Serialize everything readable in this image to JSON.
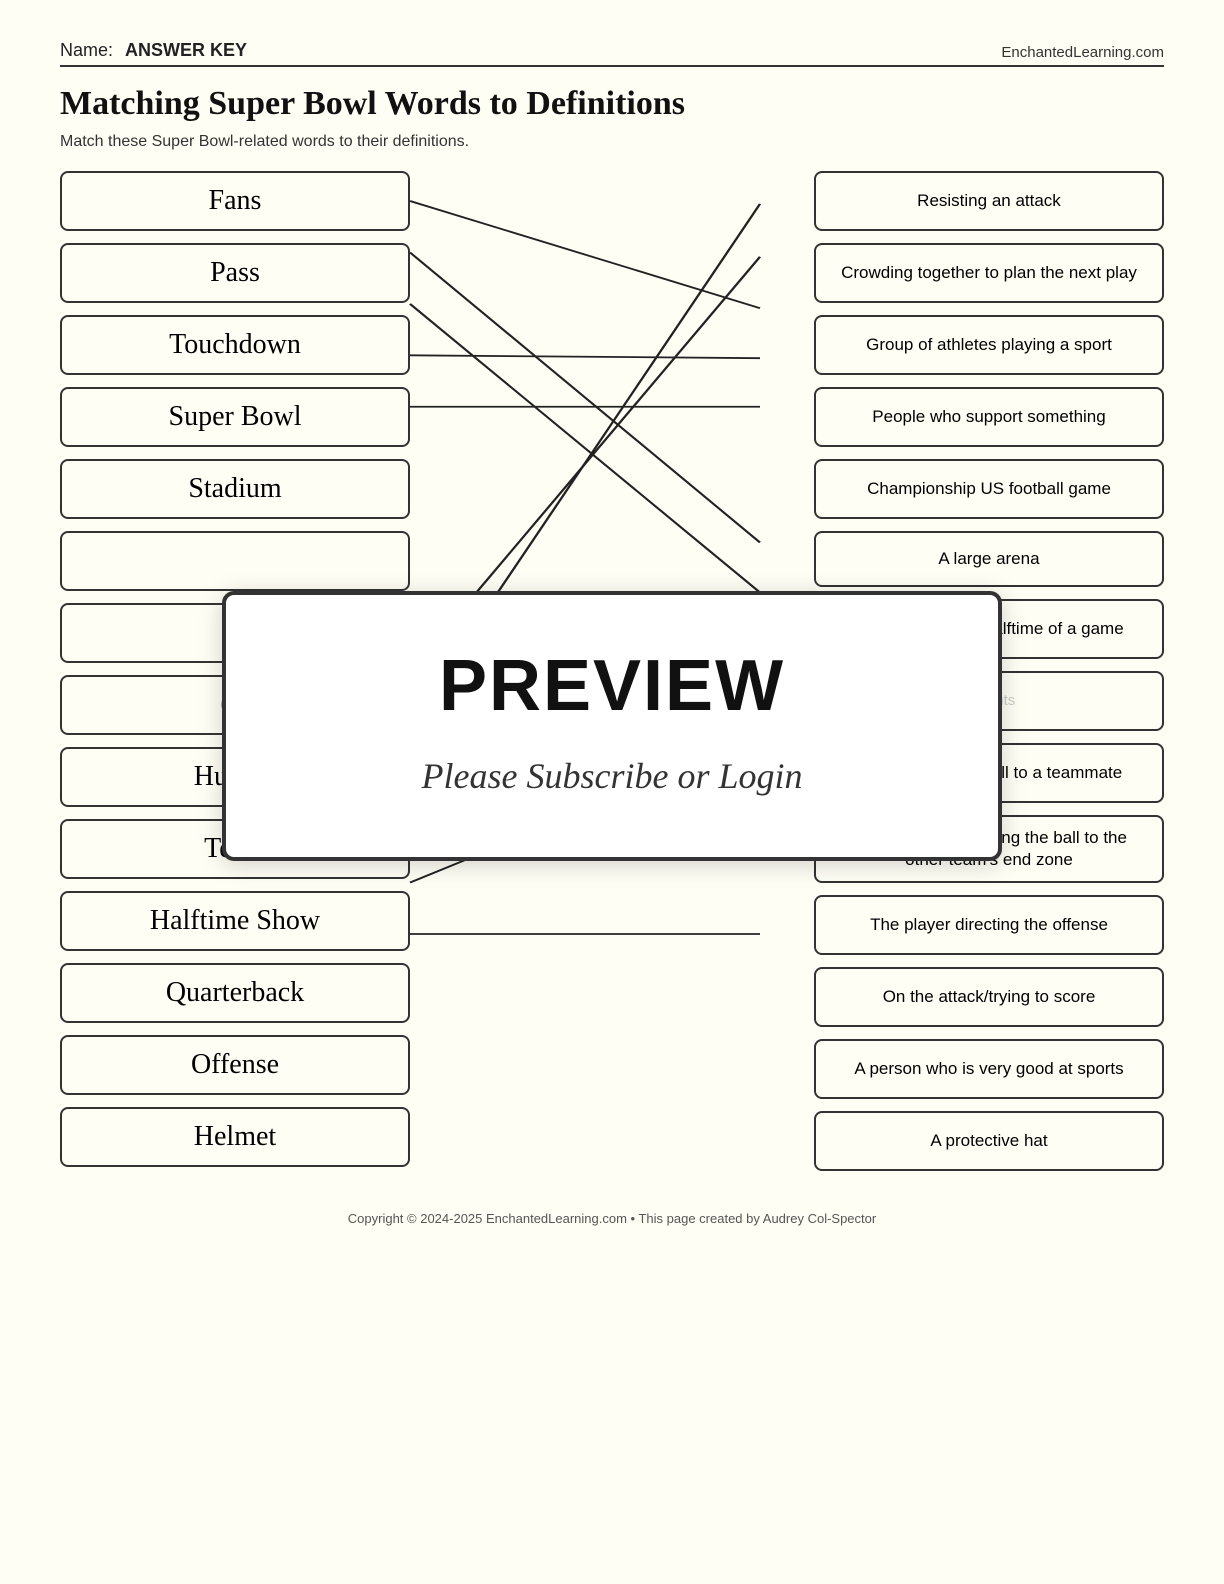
{
  "header": {
    "name_label": "Name:",
    "name_value": "ANSWER KEY",
    "site": "EnchantedLearning.com"
  },
  "title": "Matching Super Bowl Words to Definitions",
  "subtitle": "Match these Super Bowl-related words to their definitions.",
  "words": [
    {
      "id": "fans",
      "label": "Fans"
    },
    {
      "id": "pass",
      "label": "Pass"
    },
    {
      "id": "touchdown",
      "label": "Touchdown"
    },
    {
      "id": "superbowl",
      "label": "Super Bowl"
    },
    {
      "id": "stadium",
      "label": "Stadium"
    },
    {
      "id": "word6",
      "label": ""
    },
    {
      "id": "word7",
      "label": ""
    },
    {
      "id": "quarterback_off",
      "label": "Q..."
    },
    {
      "id": "huddle",
      "label": "Huddle"
    },
    {
      "id": "team",
      "label": "Team"
    },
    {
      "id": "halftimeshow",
      "label": "Halftime Show"
    },
    {
      "id": "quarterback",
      "label": "Quarterback"
    },
    {
      "id": "offense",
      "label": "Offense"
    },
    {
      "id": "helmet",
      "label": "Helmet"
    }
  ],
  "definitions": [
    {
      "id": "def_resist",
      "text": "Resisting an attack"
    },
    {
      "id": "def_crowd",
      "text": "Crowding together to plan the next play"
    },
    {
      "id": "def_group",
      "text": "Group of athletes playing a sport"
    },
    {
      "id": "def_people",
      "text": "People who support something"
    },
    {
      "id": "def_champ",
      "text": "Championship US football game"
    },
    {
      "id": "def_arena",
      "text": "A large arena"
    },
    {
      "id": "def_game",
      "text": "Entertainment at halftime of a game"
    },
    {
      "id": "def_points",
      "text": "Scored when the ball crosses the end zone to score points"
    },
    {
      "id": "def_throw",
      "text": "Throw/move the ball to a teammate"
    },
    {
      "id": "def_score",
      "text": "Score in football; bring the ball to the other team's end zone"
    },
    {
      "id": "def_player",
      "text": "The player directing the offense"
    },
    {
      "id": "def_attack",
      "text": "On the attack/trying to score"
    },
    {
      "id": "def_good",
      "text": "A person who is very good at sports"
    },
    {
      "id": "def_hat",
      "text": "A protective hat"
    }
  ],
  "preview": {
    "title": "PREVIEW",
    "subtitle": "Please Subscribe or Login"
  },
  "footer": "Copyright © 2024-2025 EnchantedLearning.com • This page created by Audrey Col-Spector"
}
